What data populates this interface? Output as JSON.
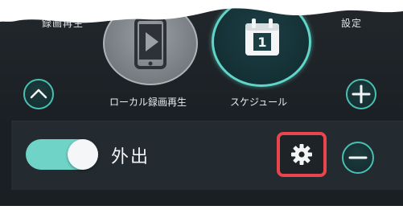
{
  "top_nav": {
    "left_label": "録画再生",
    "right_label": "設定"
  },
  "modes": [
    {
      "label": "ローカル録画再生",
      "icon": "phone-play-icon"
    },
    {
      "label": "スケジュール",
      "icon": "calendar-icon",
      "date_number": "1"
    }
  ],
  "schedule_row": {
    "label": "外出",
    "toggle_on": true,
    "settings_icon": "gear-icon"
  },
  "controls": {
    "up_icon": "chevron-up-icon",
    "add_icon": "plus-icon",
    "remove_icon": "minus-icon"
  },
  "colors": {
    "accent": "#49bfb2",
    "toggle_on": "#6fd3c8",
    "highlight_frame": "#e8464c",
    "background": "#1b2025"
  }
}
